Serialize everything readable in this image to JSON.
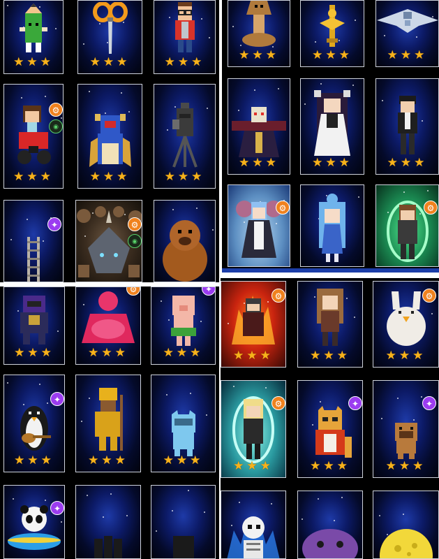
{
  "colors": {
    "star": "#f7b21b",
    "badge_orange": "#f0821e",
    "badge_purple": "#9b3cf0",
    "card_border": "#cfd3dc"
  },
  "quadrants": [
    {
      "name": "top-left",
      "cards": [
        {
          "character": "pencil-character",
          "stars": "★★★",
          "badges": []
        },
        {
          "character": "scissors",
          "stars": "★★★",
          "badges": []
        },
        {
          "character": "nerd-character",
          "stars": "★★★",
          "badges": []
        },
        {
          "character": "girl-on-motorbike",
          "stars": "★★★",
          "badges": [
            {
              "type": "orange",
              "glyph": "⚙"
            },
            {
              "type": "mini",
              "glyph": "◉"
            }
          ]
        },
        {
          "character": "blue-dragon",
          "stars": "★★★",
          "badges": []
        },
        {
          "character": "film-camera",
          "stars": "★★★",
          "badges": []
        },
        {
          "character": "ladder",
          "stars": "",
          "badges": [
            {
              "type": "purple",
              "glyph": "✦"
            }
          ]
        },
        {
          "character": "rhino-beast",
          "stars": "",
          "badges": [
            {
              "type": "orange",
              "glyph": "⚙"
            },
            {
              "type": "mini",
              "glyph": "◉"
            }
          ]
        },
        {
          "character": "mole",
          "stars": "",
          "badges": []
        }
      ]
    },
    {
      "name": "top-right",
      "cards": [
        {
          "character": "cobra",
          "stars": "★★★",
          "badges": []
        },
        {
          "character": "golden-totem",
          "stars": "★★★",
          "badges": []
        },
        {
          "character": "manta-ship",
          "stars": "★★★",
          "badges": []
        },
        {
          "character": "skeleton-overlord",
          "stars": "★★★",
          "badges": []
        },
        {
          "character": "dark-haired-girl",
          "stars": "★★★",
          "badges": []
        },
        {
          "character": "black-haired-boy",
          "stars": "★★★",
          "badges": []
        },
        {
          "character": "maid-girl",
          "stars": "",
          "badges": [
            {
              "type": "orange",
              "glyph": "⚙"
            }
          ]
        },
        {
          "character": "blue-haired-girl",
          "stars": "",
          "badges": []
        },
        {
          "character": "green-aura-fighter",
          "stars": "",
          "badges": [
            {
              "type": "orange",
              "glyph": "⚙"
            }
          ]
        }
      ]
    },
    {
      "name": "bottom-left",
      "cards": [
        {
          "character": "purple-robot",
          "stars": "★★★",
          "badges": []
        },
        {
          "character": "pink-buddha",
          "stars": "★★★",
          "badges": [
            {
              "type": "orange",
              "glyph": "⚙"
            }
          ]
        },
        {
          "character": "pig-hula",
          "stars": "★★★",
          "badges": [
            {
              "type": "purple",
              "glyph": "✦"
            }
          ]
        },
        {
          "character": "penguin-ukulele",
          "stars": "★★★",
          "badges": [
            {
              "type": "purple",
              "glyph": "✦"
            }
          ]
        },
        {
          "character": "golden-warrior",
          "stars": "★★★",
          "badges": []
        },
        {
          "character": "blue-cat-snorkel",
          "stars": "★★★",
          "badges": []
        },
        {
          "character": "panda-float",
          "stars": "",
          "badges": [
            {
              "type": "purple",
              "glyph": "✦"
            }
          ]
        },
        {
          "character": "dark-hair-heads",
          "stars": "",
          "badges": []
        },
        {
          "character": "dark-hair-head",
          "stars": "",
          "badges": []
        }
      ]
    },
    {
      "name": "bottom-right",
      "cards": [
        {
          "character": "fire-warrior",
          "stars": "★★★",
          "badges": [
            {
              "type": "orange",
              "glyph": "⚙"
            }
          ]
        },
        {
          "character": "raccoon-girl",
          "stars": "★★★",
          "badges": []
        },
        {
          "character": "white-bird-bunny",
          "stars": "★★★",
          "badges": [
            {
              "type": "orange",
              "glyph": "⚙"
            }
          ]
        },
        {
          "character": "blonde-aura-fighter",
          "stars": "★★★",
          "badges": [
            {
              "type": "orange",
              "glyph": "⚙"
            }
          ]
        },
        {
          "character": "tiger-cat",
          "stars": "★★★",
          "badges": [
            {
              "type": "purple",
              "glyph": "✦"
            }
          ]
        },
        {
          "character": "brown-pug",
          "stars": "★★★",
          "badges": [
            {
              "type": "purple",
              "glyph": "✦"
            }
          ]
        },
        {
          "character": "skeleton-blue-flame",
          "stars": "",
          "badges": []
        },
        {
          "character": "purple-octopus",
          "stars": "",
          "badges": []
        },
        {
          "character": "yellow-moon",
          "stars": "",
          "badges": []
        }
      ]
    }
  ]
}
